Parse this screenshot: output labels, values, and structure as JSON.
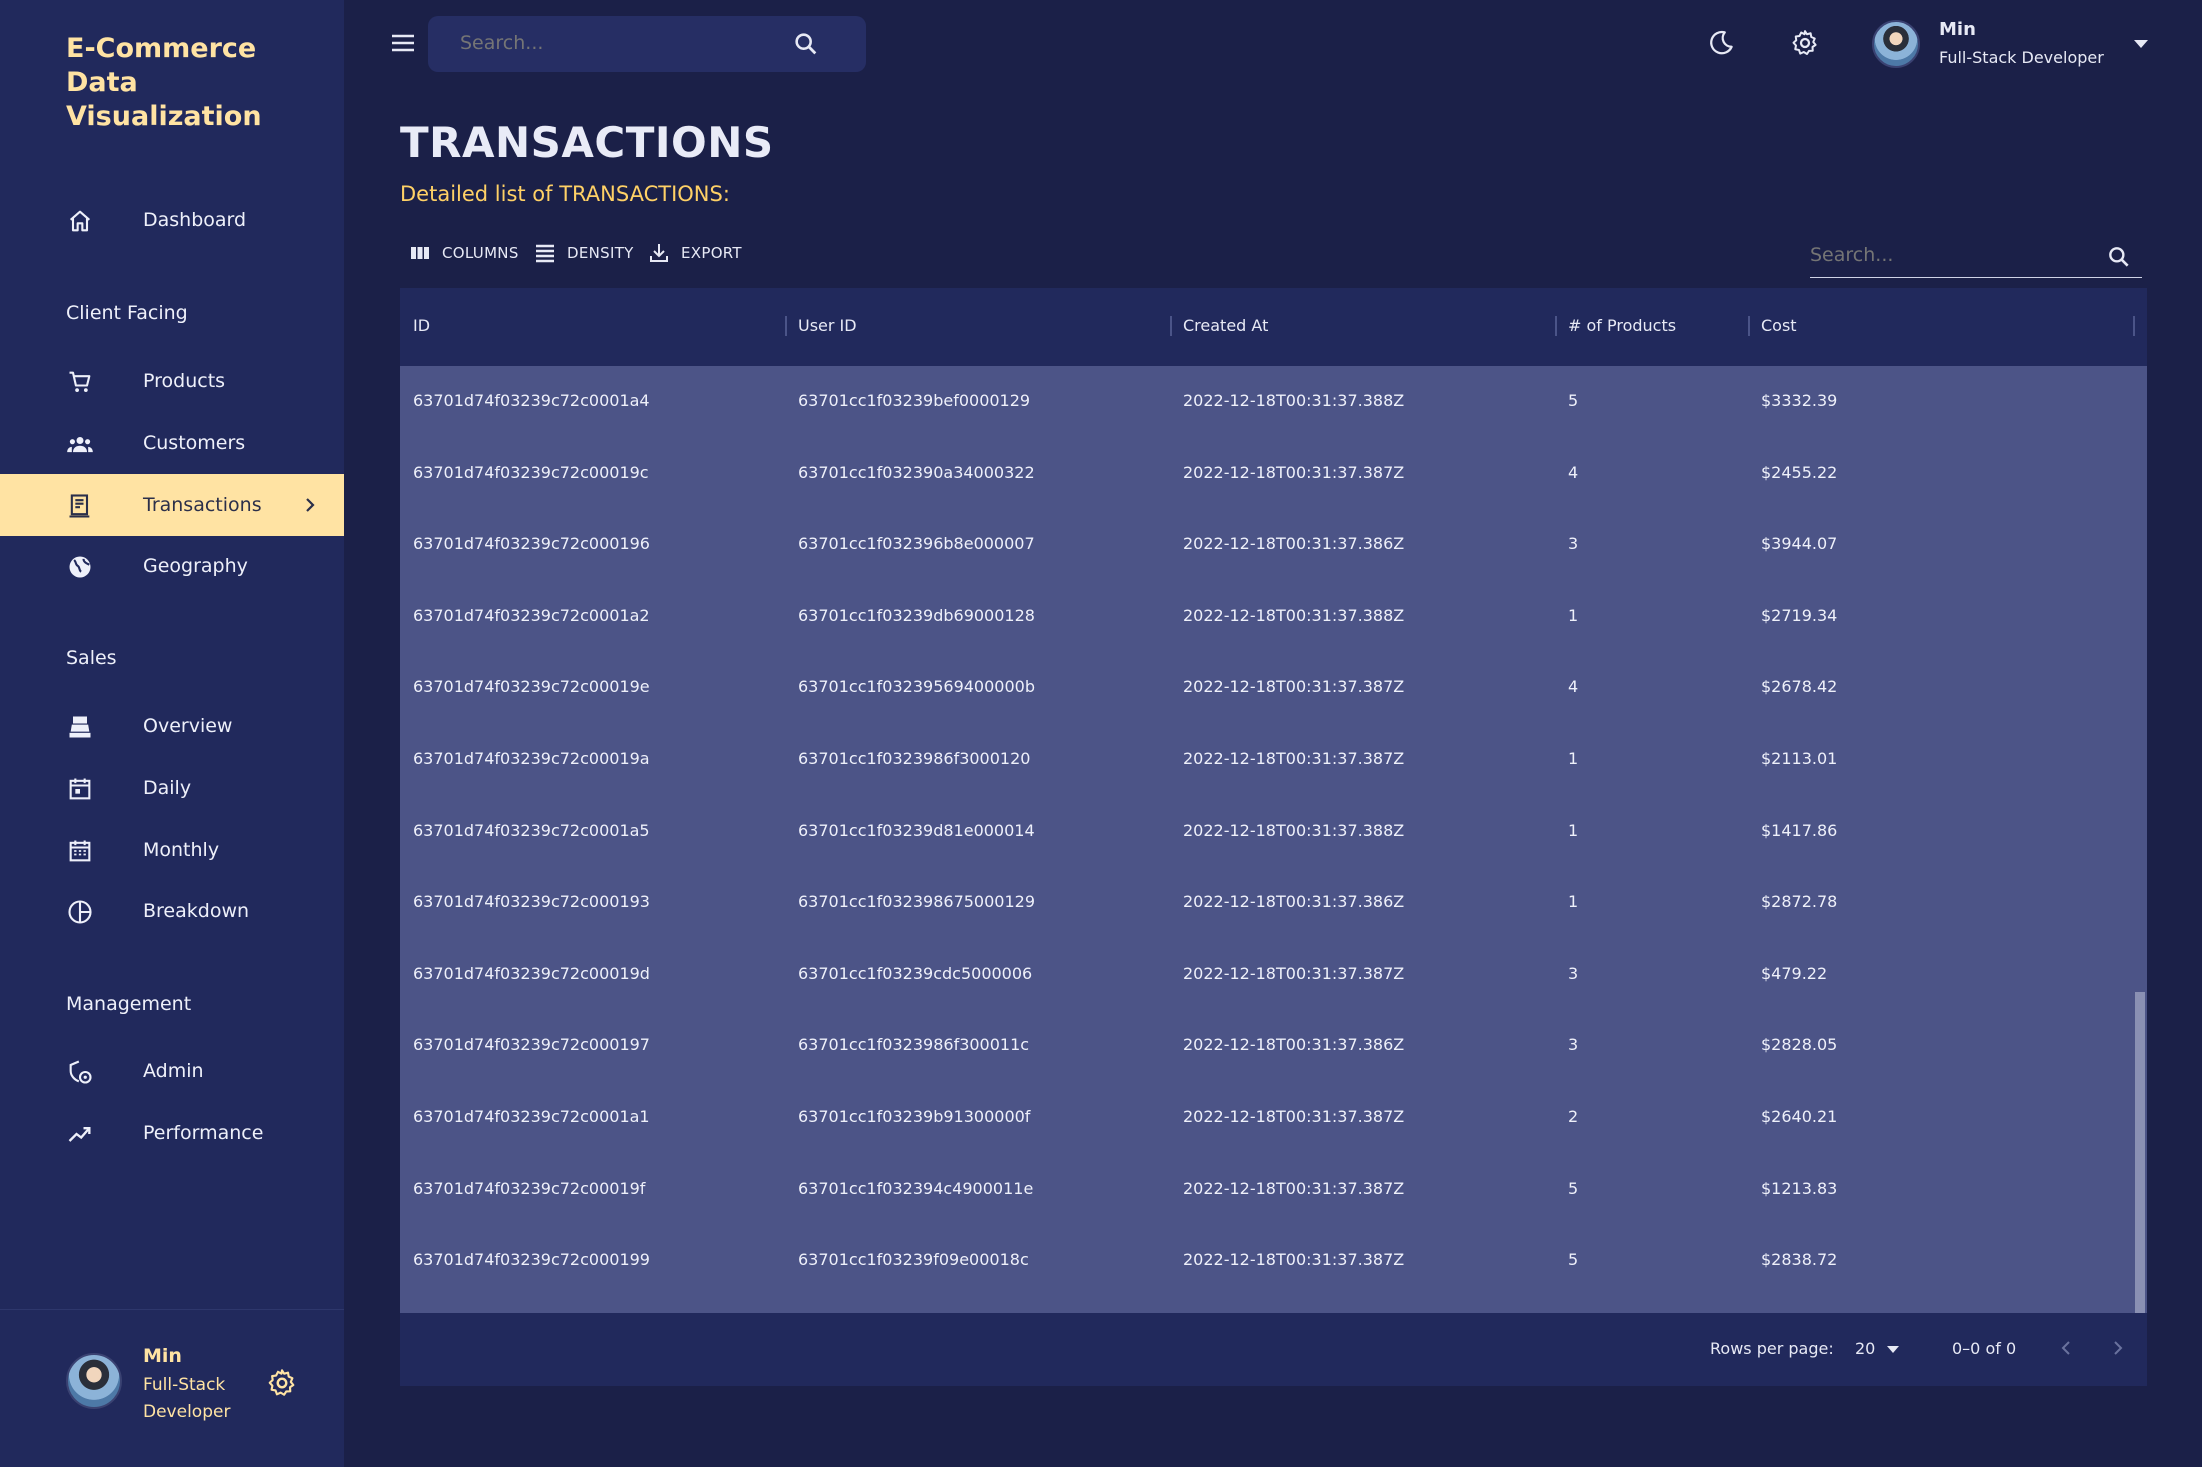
{
  "sidebar": {
    "brand": "E-Commerce Data Visualization",
    "dashboard": "Dashboard",
    "sections": {
      "client": "Client Facing",
      "sales": "Sales",
      "management": "Management"
    },
    "items": {
      "products": "Products",
      "customers": "Customers",
      "transactions": "Transactions",
      "geography": "Geography",
      "overview": "Overview",
      "daily": "Daily",
      "monthly": "Monthly",
      "breakdown": "Breakdown",
      "admin": "Admin",
      "performance": "Performance"
    },
    "active": "transactions",
    "user": {
      "name": "Min",
      "role": "Full-Stack Developer"
    }
  },
  "topbar": {
    "search_placeholder": "Search...",
    "user": {
      "name": "Min",
      "role": "Full-Stack Developer"
    }
  },
  "page": {
    "title": "TRANSACTIONS",
    "subtitle": "Detailed list of TRANSACTIONS:"
  },
  "toolbar": {
    "columns": "COLUMNS",
    "density": "DENSITY",
    "export": "EXPORT",
    "search_placeholder": "Search..."
  },
  "table": {
    "headers": {
      "id": "ID",
      "user_id": "User ID",
      "created_at": "Created At",
      "products": "# of Products",
      "cost": "Cost"
    },
    "rows": [
      [
        "63701d74f03239c72c0001a4",
        "63701cc1f03239bef0000129",
        "2022-12-18T00:31:37.388Z",
        "5",
        "$3332.39"
      ],
      [
        "63701d74f03239c72c00019c",
        "63701cc1f032390a34000322",
        "2022-12-18T00:31:37.387Z",
        "4",
        "$2455.22"
      ],
      [
        "63701d74f03239c72c000196",
        "63701cc1f032396b8e000007",
        "2022-12-18T00:31:37.386Z",
        "3",
        "$3944.07"
      ],
      [
        "63701d74f03239c72c0001a2",
        "63701cc1f03239db69000128",
        "2022-12-18T00:31:37.388Z",
        "1",
        "$2719.34"
      ],
      [
        "63701d74f03239c72c00019e",
        "63701cc1f03239569400000b",
        "2022-12-18T00:31:37.387Z",
        "4",
        "$2678.42"
      ],
      [
        "63701d74f03239c72c00019a",
        "63701cc1f0323986f3000120",
        "2022-12-18T00:31:37.387Z",
        "1",
        "$2113.01"
      ],
      [
        "63701d74f03239c72c0001a5",
        "63701cc1f03239d81e000014",
        "2022-12-18T00:31:37.388Z",
        "1",
        "$1417.86"
      ],
      [
        "63701d74f03239c72c000193",
        "63701cc1f032398675000129",
        "2022-12-18T00:31:37.386Z",
        "1",
        "$2872.78"
      ],
      [
        "63701d74f03239c72c00019d",
        "63701cc1f03239cdc5000006",
        "2022-12-18T00:31:37.387Z",
        "3",
        "$479.22"
      ],
      [
        "63701d74f03239c72c000197",
        "63701cc1f0323986f300011c",
        "2022-12-18T00:31:37.386Z",
        "3",
        "$2828.05"
      ],
      [
        "63701d74f03239c72c0001a1",
        "63701cc1f03239b91300000f",
        "2022-12-18T00:31:37.387Z",
        "2",
        "$2640.21"
      ],
      [
        "63701d74f03239c72c00019f",
        "63701cc1f032394c4900011e",
        "2022-12-18T00:31:37.387Z",
        "5",
        "$1213.83"
      ],
      [
        "63701d74f03239c72c000199",
        "63701cc1f03239f09e00018c",
        "2022-12-18T00:31:37.387Z",
        "5",
        "$2838.72"
      ]
    ]
  },
  "footer": {
    "rows_per_page_label": "Rows per page:",
    "rows_per_page_value": "20",
    "range": "0–0 of 0"
  },
  "colors": {
    "background": "#1b2048",
    "sidebar": "#21295c",
    "accent": "#ffe3a3",
    "subtitle": "#ffd166",
    "grid_body": "#4c5487"
  }
}
